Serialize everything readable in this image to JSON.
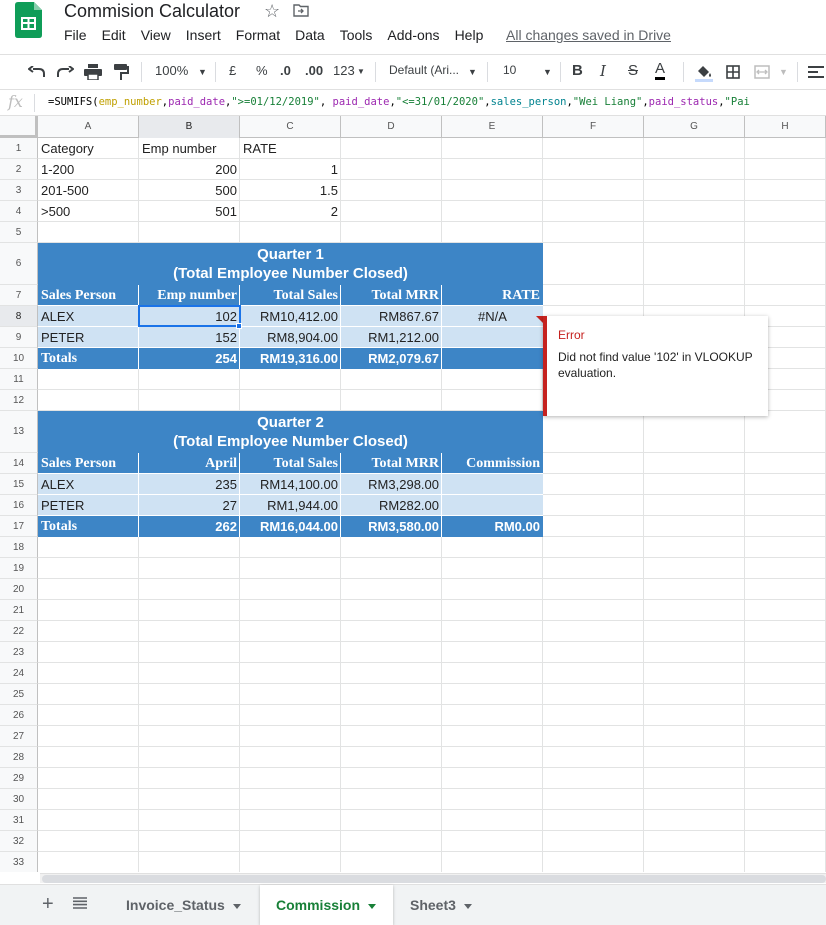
{
  "app": {
    "title": "Commision Calculator",
    "saved_status": "All changes saved in Drive",
    "menu": [
      "File",
      "Edit",
      "View",
      "Insert",
      "Format",
      "Data",
      "Tools",
      "Add-ons",
      "Help"
    ]
  },
  "toolbar": {
    "zoom": "100%",
    "currency": "£",
    "percent": "%",
    "dec_less": ".0",
    "dec_more": ".00",
    "more_formats": "123",
    "font": "Default (Ari...",
    "font_size": "10",
    "bold": "B",
    "italic": "I",
    "strike": "S",
    "text_color": "A"
  },
  "formula_bar": {
    "fx": "fx",
    "parts": [
      {
        "text": "=SUMIFS(",
        "style": "plain"
      },
      {
        "text": "emp_number",
        "style": "range"
      },
      {
        "text": ",",
        "style": "plain"
      },
      {
        "text": "paid_date",
        "style": "range2"
      },
      {
        "text": ",",
        "style": "plain"
      },
      {
        "text": "\">=01/12/2019\"",
        "style": "str"
      },
      {
        "text": ", ",
        "style": "plain"
      },
      {
        "text": "paid_date",
        "style": "range2"
      },
      {
        "text": ",",
        "style": "plain"
      },
      {
        "text": "\"<=31/01/2020\"",
        "style": "str"
      },
      {
        "text": ",",
        "style": "plain"
      },
      {
        "text": "sales_person",
        "style": "teal"
      },
      {
        "text": ",",
        "style": "plain"
      },
      {
        "text": "\"Wei Liang\"",
        "style": "str"
      },
      {
        "text": ",",
        "style": "plain"
      },
      {
        "text": "paid_status",
        "style": "range2"
      },
      {
        "text": ",",
        "style": "plain"
      },
      {
        "text": "\"Pai",
        "style": "str"
      }
    ]
  },
  "grid": {
    "columns": [
      "A",
      "B",
      "C",
      "D",
      "E",
      "F",
      "G",
      "H"
    ],
    "rows": [
      "1",
      "2",
      "3",
      "4",
      "5",
      "6",
      "7",
      "8",
      "9",
      "10",
      "11",
      "12",
      "13",
      "14",
      "15",
      "16",
      "17",
      "18",
      "19",
      "20",
      "21",
      "22",
      "23",
      "24",
      "25",
      "26",
      "27",
      "28",
      "29",
      "30",
      "31",
      "32",
      "33"
    ],
    "selected_cell": "B8"
  },
  "rate_table": {
    "headers": [
      "Category",
      "Emp number",
      "RATE"
    ],
    "rows": [
      [
        "1-200",
        "200",
        "1"
      ],
      [
        "201-500",
        "500",
        "1.5"
      ],
      [
        ">500",
        "501",
        "2"
      ]
    ]
  },
  "q1": {
    "title_line1": "Quarter 1",
    "title_line2": "(Total Employee Number Closed)",
    "headers": [
      "Sales Person",
      "Emp number",
      "Total Sales",
      "Total MRR",
      "RATE"
    ],
    "rows": [
      [
        "ALEX",
        "102",
        "RM10,412.00",
        "RM867.67",
        "#N/A"
      ],
      [
        "PETER",
        "152",
        "RM8,904.00",
        "RM1,212.00",
        ""
      ]
    ],
    "totals": [
      "Totals",
      "254",
      "RM19,316.00",
      "RM2,079.67",
      ""
    ]
  },
  "q2": {
    "title_line1": "Quarter 2",
    "title_line2": "(Total Employee Number Closed)",
    "headers": [
      "Sales Person",
      "April",
      "Total Sales",
      "Total MRR",
      "Commission"
    ],
    "rows": [
      [
        "ALEX",
        "235",
        "RM14,100.00",
        "RM3,298.00",
        ""
      ],
      [
        "PETER",
        "27",
        "RM1,944.00",
        "RM282.00",
        ""
      ]
    ],
    "totals": [
      "Totals",
      "262",
      "RM16,044.00",
      "RM3,580.00",
      "RM0.00"
    ]
  },
  "error": {
    "title": "Error",
    "message": "Did not find value '102' in VLOOKUP evaluation."
  },
  "sheets": {
    "tabs": [
      "Invoice_Status",
      "Commission",
      "Sheet3"
    ],
    "active": "Commission"
  },
  "colors": {
    "header_blue": "#3d85c6",
    "light_blue": "#cfe2f3",
    "error_red": "#c5221f",
    "active_tab_green": "#188038",
    "selection_blue": "#1a73e8"
  }
}
